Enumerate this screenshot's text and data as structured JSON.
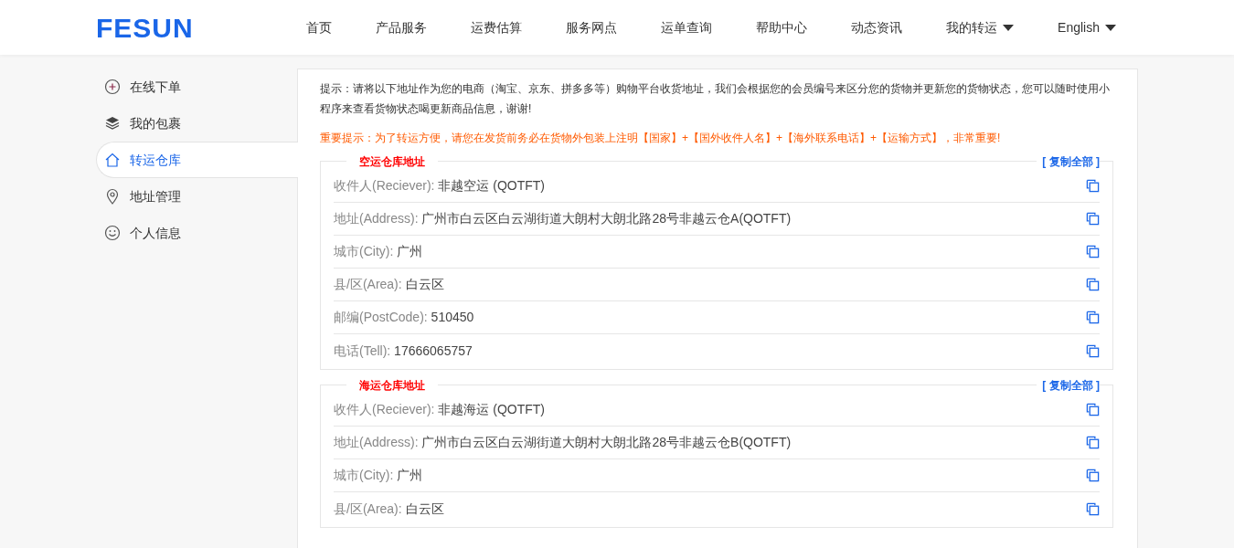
{
  "header": {
    "logo": "FESUN",
    "nav": [
      {
        "label": "首页",
        "dropdown": false
      },
      {
        "label": "产品服务",
        "dropdown": false
      },
      {
        "label": "运费估算",
        "dropdown": false
      },
      {
        "label": "服务网点",
        "dropdown": false
      },
      {
        "label": "运单查询",
        "dropdown": false
      },
      {
        "label": "帮助中心",
        "dropdown": false
      },
      {
        "label": "动态资讯",
        "dropdown": false
      },
      {
        "label": "我的转运",
        "dropdown": true
      },
      {
        "label": "English",
        "dropdown": true
      }
    ]
  },
  "sidebar": {
    "items": [
      {
        "label": "在线下单",
        "kind": "plus",
        "selected": false
      },
      {
        "label": "我的包裹",
        "kind": "layers",
        "selected": false
      },
      {
        "label": "转运仓库",
        "kind": "house",
        "selected": true
      },
      {
        "label": "地址管理",
        "kind": "pin",
        "selected": false
      },
      {
        "label": "个人信息",
        "kind": "smile",
        "selected": false
      }
    ]
  },
  "notice": "提示：请将以下地址作为您的电商（淘宝、京东、拼多多等）购物平台收货地址，我们会根据您的会员编号来区分您的货物并更新您的货物状态，您可以随时使用小程序来查看货物状态喝更新商品信息，谢谢!",
  "important_notice": "重要提示：为了转运方便，请您在发货前务必在货物外包装上注明【国家】+【国外收件人名】+【海外联系电话】+【运输方式】，非常重要!",
  "sections": [
    {
      "title": "空运仓库地址",
      "copy_all": "[ 复制全部 ]",
      "rows": [
        {
          "label": "收件人(Reciever):",
          "value": "非越空运 (QOTFT)"
        },
        {
          "label": "地址(Address):",
          "value": "广州市白云区白云湖街道大朗村大朗北路28号非越云仓A(QOTFT)"
        },
        {
          "label": "城市(City):",
          "value": "广州"
        },
        {
          "label": "县/区(Area):",
          "value": "白云区"
        },
        {
          "label": "邮编(PostCode):",
          "value": "510450"
        },
        {
          "label": "电话(Tell):",
          "value": "17666065757"
        }
      ]
    },
    {
      "title": "海运仓库地址",
      "copy_all": "[ 复制全部 ]",
      "rows": [
        {
          "label": "收件人(Reciever):",
          "value": "非越海运 (QOTFT)"
        },
        {
          "label": "地址(Address):",
          "value": "广州市白云区白云湖街道大朗村大朗北路28号非越云仓B(QOTFT)"
        },
        {
          "label": "城市(City):",
          "value": "广州"
        },
        {
          "label": "县/区(Area):",
          "value": "白云区"
        }
      ]
    }
  ]
}
